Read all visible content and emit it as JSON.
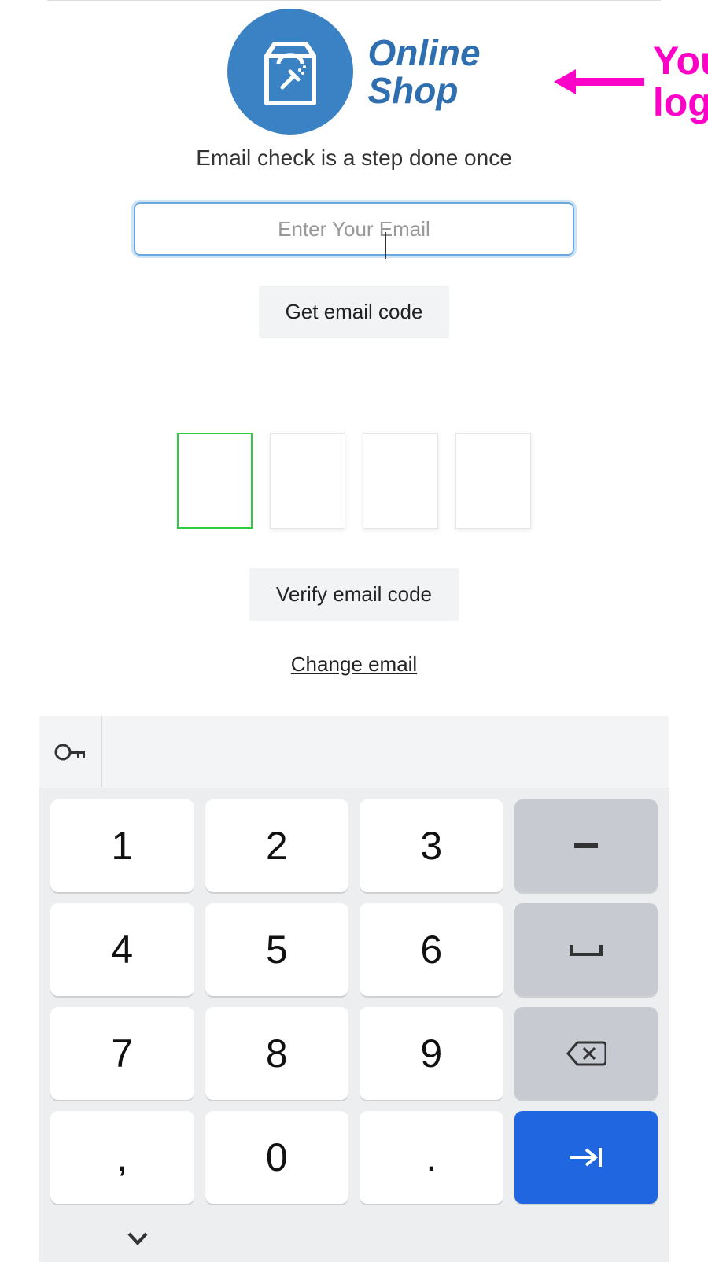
{
  "logo": {
    "line1": "Online",
    "line2": "Shop"
  },
  "annotation": {
    "line1": "Your",
    "line2": "logo"
  },
  "subtitle": "Email check is a step done once",
  "email": {
    "placeholder": "Enter Your Email",
    "value": ""
  },
  "buttons": {
    "get_code": "Get email code",
    "verify": "Verify email code"
  },
  "change_link": "Change email",
  "code_inputs": [
    "",
    "",
    "",
    ""
  ],
  "keypad": {
    "rows": [
      [
        "1",
        "2",
        "3",
        "-"
      ],
      [
        "4",
        "5",
        "6",
        "␣"
      ],
      [
        "7",
        "8",
        "9",
        "⌫"
      ],
      [
        ",",
        "0",
        ".",
        "→"
      ]
    ]
  }
}
